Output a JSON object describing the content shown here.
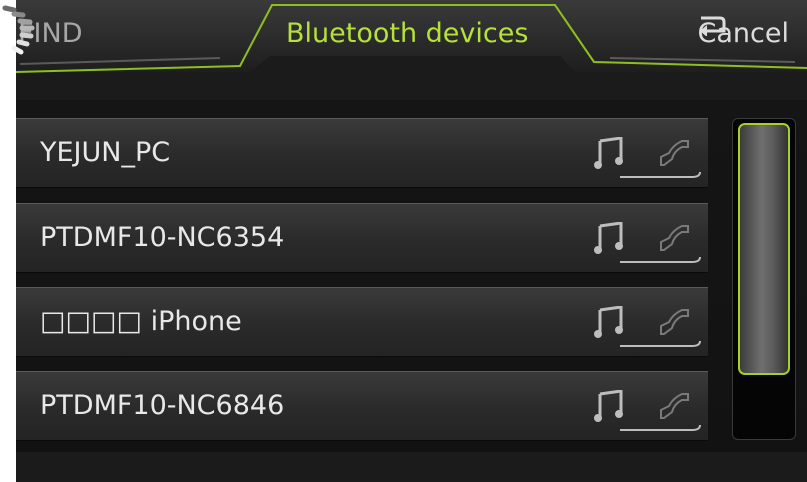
{
  "header": {
    "find_label": "FIND",
    "title": "Bluetooth devices",
    "cancel_label": "Cancel",
    "accent_color": "#b5e13a"
  },
  "devices": [
    {
      "name": "YEJUN_PC",
      "icons": [
        "music-note-icon",
        "phone-handset-icon"
      ]
    },
    {
      "name": "PTDMF10-NC6354",
      "icons": [
        "music-note-icon",
        "phone-handset-icon"
      ]
    },
    {
      "name": "□□□□ iPhone",
      "icons": [
        "music-note-icon",
        "phone-handset-icon"
      ]
    },
    {
      "name": "PTDMF10-NC6846",
      "icons": [
        "music-note-icon",
        "phone-handset-icon"
      ]
    }
  ],
  "icons": {
    "back": "back-arrow-icon",
    "spinner": "loading-spinner-icon"
  }
}
